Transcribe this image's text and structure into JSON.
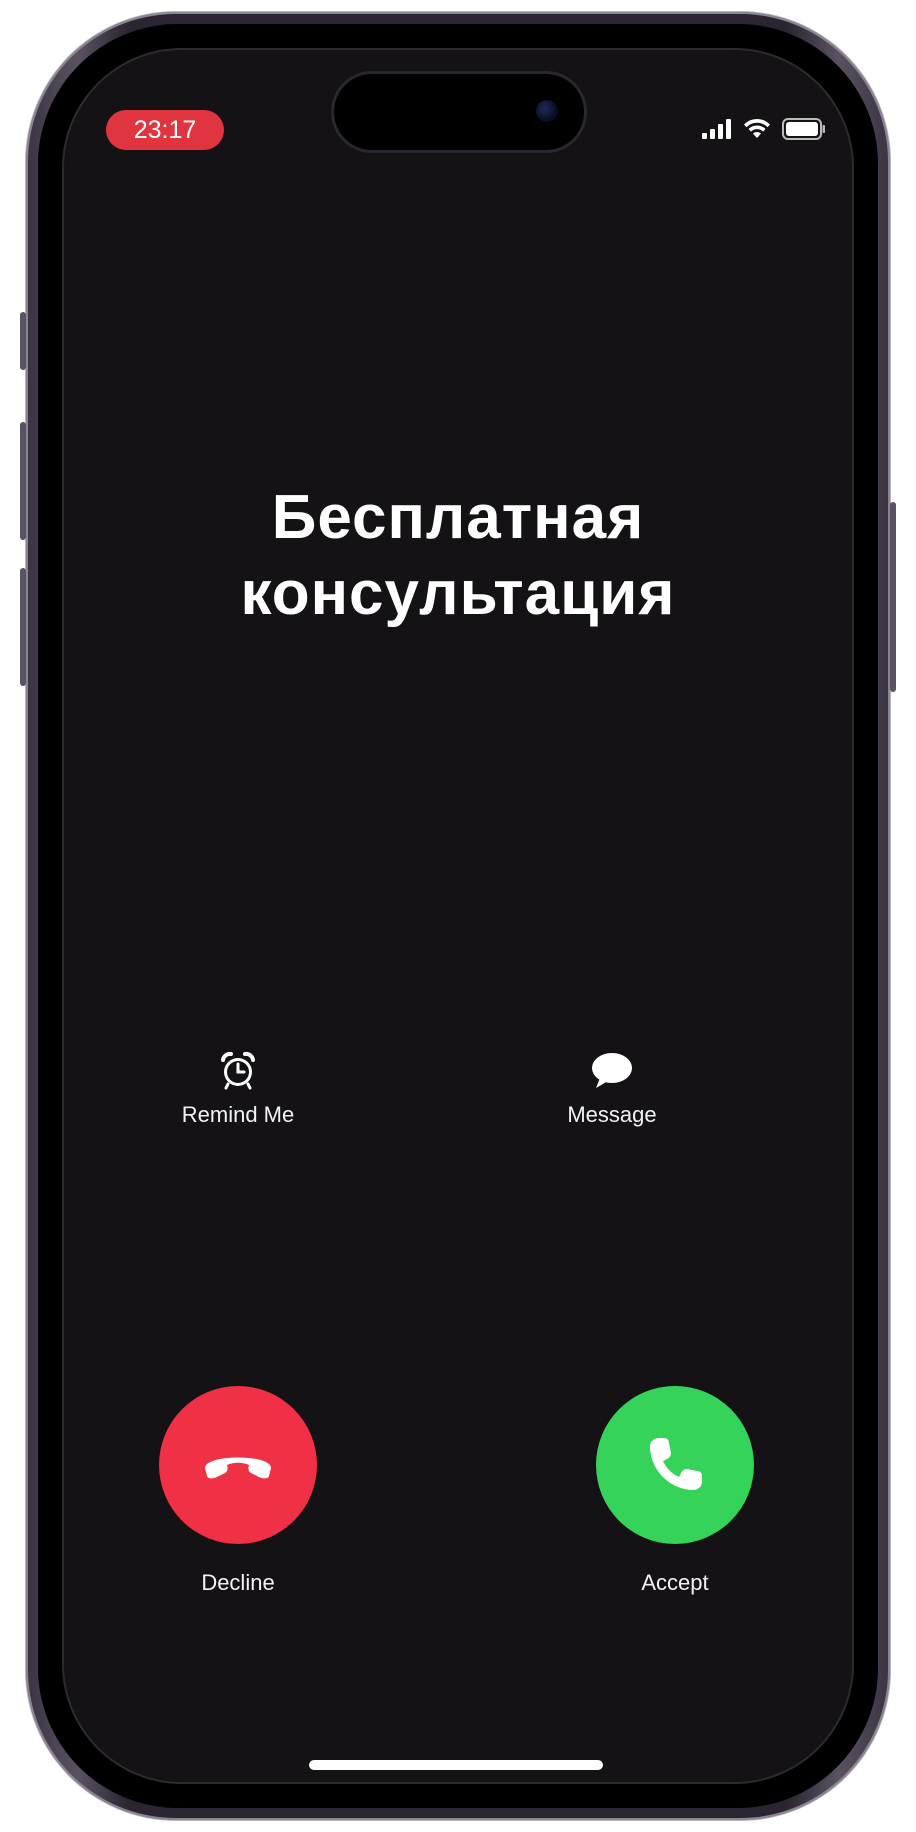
{
  "status_bar": {
    "time": "23:17",
    "time_pill_color": "#e0343f",
    "icons": [
      "cellular-signal-icon",
      "wifi-icon",
      "battery-icon"
    ]
  },
  "call": {
    "caller_line1": "Бесплатная",
    "caller_line2": "консультация"
  },
  "actions": {
    "remind_label": "Remind Me",
    "message_label": "Message"
  },
  "buttons": {
    "decline_label": "Decline",
    "accept_label": "Accept",
    "decline_color": "#ef3045",
    "accept_color": "#35d35a"
  }
}
